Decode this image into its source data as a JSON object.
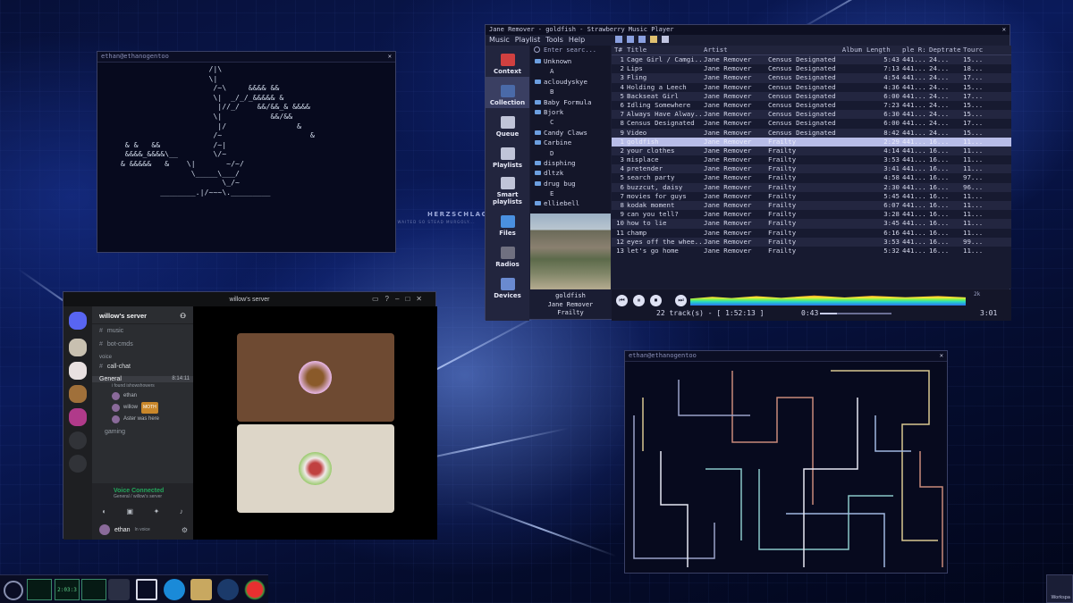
{
  "terminal1": {
    "title": "ethan@ethanogentoo",
    "close": "✕",
    "art": [
      "                      /|\\",
      "                      \\|",
      "                       /~\\     &&&& &&",
      "                       \\|  _/_/_&&&&& &",
      "                        |//_/    &&/&&_& &&&&",
      "                       \\|           &&/&&",
      "                        |/                &",
      "                       /~                    &",
      "   & &   &&            /~|",
      "   &&&&_&&&&\\__        \\/~",
      "  & &&&&&   &    \\|       ~/~/",
      "                  \\_____\\___/",
      "                         \\_/~",
      "           ________.|/~~~\\._________"
    ]
  },
  "wallpaper": {
    "text": "HERZSCHLAG",
    "sub": "I WAITED SO STEAD MURGOLY..."
  },
  "strawberry": {
    "title": "Jane Remover - goldfish - Strawberry Music Player",
    "close": "✕",
    "menu": [
      "Music",
      "Playlist",
      "Tools",
      "Help"
    ],
    "sidebar": [
      "Context",
      "Collection",
      "Queue",
      "Playlists",
      "Smart playlists",
      "Files",
      "Radios",
      "Devices"
    ],
    "search_placeholder": "Enter searc...",
    "collection": [
      {
        "t": "Unknown",
        "f": true
      },
      {
        "t": "A",
        "d": true
      },
      {
        "t": "acloudyskye",
        "f": true
      },
      {
        "t": "B",
        "d": true
      },
      {
        "t": "Baby Formula",
        "f": true
      },
      {
        "t": "Bjork",
        "f": true
      },
      {
        "t": "C",
        "d": true
      },
      {
        "t": "Candy Claws",
        "f": true
      },
      {
        "t": "Carbine",
        "f": true
      },
      {
        "t": "D",
        "d": true
      },
      {
        "t": "disphing",
        "f": true
      },
      {
        "t": "dltzk",
        "f": true
      },
      {
        "t": "drug bug",
        "f": true
      },
      {
        "t": "E",
        "d": true
      },
      {
        "t": "elliebell",
        "f": true
      }
    ],
    "now": {
      "title": "goldfish",
      "artist": "Jane Remover",
      "album": "Frailty"
    },
    "columns": [
      "T#",
      "Title",
      "Artist",
      "Album",
      "Length",
      "ple R:",
      "Deptrate",
      "Tourc"
    ],
    "tracks": [
      [
        "1",
        "Cage Girl / Camgi...",
        "Jane Remover",
        "Census Designated",
        "5:43",
        "441...",
        "24...",
        "15..."
      ],
      [
        "2",
        "Lips",
        "Jane Remover",
        "Census Designated",
        "7:13",
        "441...",
        "24...",
        "18..."
      ],
      [
        "3",
        "Fling",
        "Jane Remover",
        "Census Designated",
        "4:54",
        "441...",
        "24...",
        "17..."
      ],
      [
        "4",
        "Holding a Leech",
        "Jane Remover",
        "Census Designated",
        "4:36",
        "441...",
        "24...",
        "15..."
      ],
      [
        "5",
        "Backseat Girl",
        "Jane Remover",
        "Census Designated",
        "6:00",
        "441...",
        "24...",
        "17..."
      ],
      [
        "6",
        "Idling Somewhere",
        "Jane Remover",
        "Census Designated",
        "7:23",
        "441...",
        "24...",
        "15..."
      ],
      [
        "7",
        "Always Have Alway...",
        "Jane Remover",
        "Census Designated",
        "6:30",
        "441...",
        "24...",
        "15..."
      ],
      [
        "8",
        "Census Designated",
        "Jane Remover",
        "Census Designated",
        "6:00",
        "441...",
        "24...",
        "17..."
      ],
      [
        "9",
        "Video",
        "Jane Remover",
        "Census Designated",
        "8:42",
        "441...",
        "24...",
        "15..."
      ],
      [
        "1",
        "goldfish",
        "Jane Remover",
        "Frailty",
        "2:29",
        "441...",
        "16...",
        "11..."
      ],
      [
        "2",
        "your clothes",
        "Jane Remover",
        "Frailty",
        "4:14",
        "441...",
        "16...",
        "11..."
      ],
      [
        "3",
        "misplace",
        "Jane Remover",
        "Frailty",
        "3:53",
        "441...",
        "16...",
        "11..."
      ],
      [
        "4",
        "pretender",
        "Jane Remover",
        "Frailty",
        "3:41",
        "441...",
        "16...",
        "11..."
      ],
      [
        "5",
        "search party",
        "Jane Remover",
        "Frailty",
        "4:58",
        "441...",
        "16...",
        "97..."
      ],
      [
        "6",
        "buzzcut, daisy",
        "Jane Remover",
        "Frailty",
        "2:30",
        "441...",
        "16...",
        "96..."
      ],
      [
        "7",
        "movies for guys",
        "Jane Remover",
        "Frailty",
        "5:45",
        "441...",
        "16...",
        "11..."
      ],
      [
        "8",
        "kodak moment",
        "Jane Remover",
        "Frailty",
        "6:07",
        "441...",
        "16...",
        "11..."
      ],
      [
        "9",
        "can you tell?",
        "Jane Remover",
        "Frailty",
        "3:28",
        "441...",
        "16...",
        "11..."
      ],
      [
        "10",
        "how to lie",
        "Jane Remover",
        "Frailty",
        "3:45",
        "441...",
        "16...",
        "11..."
      ],
      [
        "11",
        "champ",
        "Jane Remover",
        "Frailty",
        "6:16",
        "441...",
        "16...",
        "11..."
      ],
      [
        "12",
        "eyes off the whee...",
        "Jane Remover",
        "Frailty",
        "3:53",
        "441...",
        "16...",
        "99..."
      ],
      [
        "13",
        "let's go home",
        "Jane Remover",
        "Frailty",
        "5:32",
        "441...",
        "16...",
        "11..."
      ]
    ],
    "playing_index": 9,
    "status": "22 track(s) - [ 1:52:13 ]",
    "elapsed": "0:43",
    "total": "3:01",
    "progress": 0.24,
    "volume_label": "2k"
  },
  "discord": {
    "title": "willow's server",
    "server": "willow's server",
    "channels": [
      "music",
      "bot-cmds"
    ],
    "category": "voice",
    "voice_channels": [
      "call-chat"
    ],
    "general": {
      "name": "General",
      "time": "8:14:11",
      "status": "i found ishowshowers"
    },
    "members": [
      {
        "name": "ethan",
        "tag": ""
      },
      {
        "name": "willow",
        "tag": "MOTH"
      },
      {
        "name": "Aster was here",
        "tag": ""
      }
    ],
    "other_channel": "gaming",
    "voice_connected": "Voice Connected",
    "voice_sub": "General / willow's server",
    "user": "ethan",
    "user_status": "In voice",
    "badge": "2",
    "colors": {
      "tile1": "#6e4a32",
      "tile2": "#ddd6c8",
      "blurple": "#5865f2",
      "green": "#23a55a"
    }
  },
  "terminal2": {
    "title": "ethan@ethanogentoo",
    "close": "✕"
  },
  "taskbar": {
    "clock": "2:03:3",
    "workspace_label": "Workspa"
  }
}
